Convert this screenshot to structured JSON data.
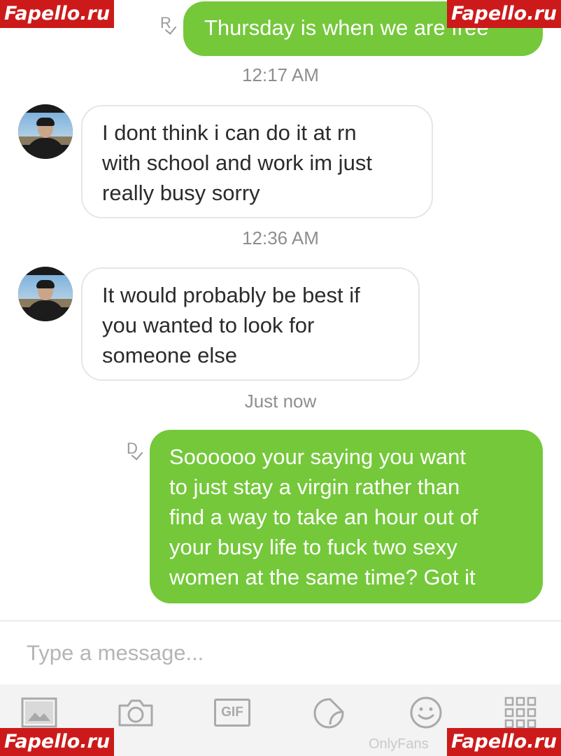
{
  "watermarks": {
    "top_left": "Fapello.ru",
    "top_right": "Fapello.ru",
    "bottom_left": "Fapello.ru",
    "bottom_right": "Fapello.ru"
  },
  "conversation": {
    "messages": [
      {
        "direction": "outgoing",
        "receipt": "R",
        "text": "Thursday is when we are free"
      },
      {
        "timestamp": "12:17 AM"
      },
      {
        "direction": "incoming",
        "text_lines": [
          "I dont think i can do it at rn",
          "with school and work im just",
          "really busy sorry"
        ]
      },
      {
        "timestamp": "12:36 AM"
      },
      {
        "direction": "incoming",
        "text_lines": [
          "It would probably be best if",
          "you wanted to look for",
          "someone else"
        ]
      },
      {
        "timestamp": "Just now"
      },
      {
        "direction": "outgoing",
        "receipt": "D",
        "text_lines": [
          "Soooooo your saying you want",
          "to just stay a virgin rather than",
          "find a way to take an hour out of",
          "your busy life to fuck two sexy",
          "women at the same time? Got it"
        ]
      }
    ]
  },
  "composer": {
    "placeholder": "Type a message..."
  },
  "toolbar": {
    "gif_label": "GIF",
    "icons": [
      "image-icon",
      "camera-icon",
      "gif-icon",
      "sticker-icon",
      "emoji-icon",
      "grid-icon"
    ]
  },
  "brand_text": "OnlyFans",
  "colors": {
    "outgoing_bubble": "#74c83a",
    "incoming_border": "#e6e6e6",
    "watermark": "#cc1a1a"
  }
}
